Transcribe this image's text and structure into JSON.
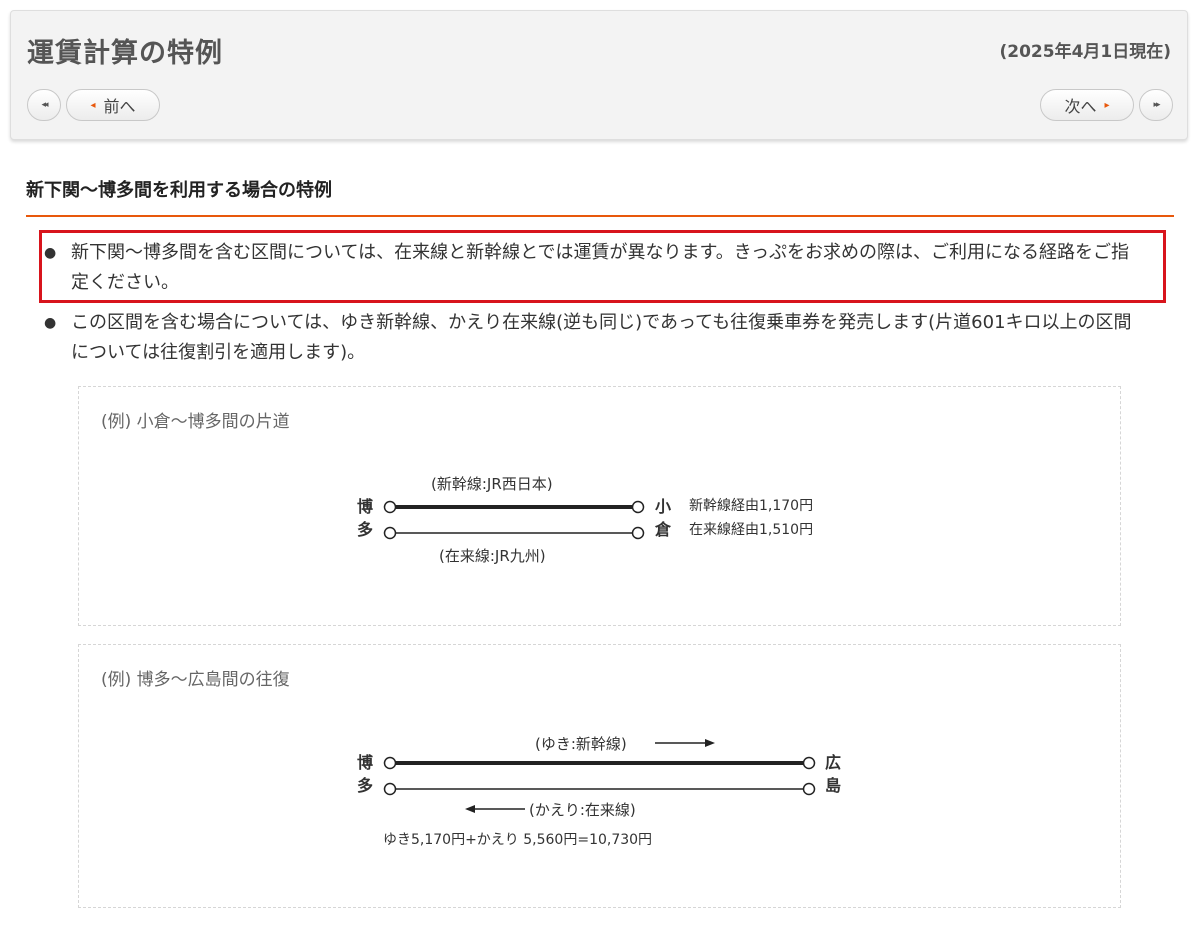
{
  "header": {
    "title": "運賃計算の特例",
    "as_of": "(2025年4月1日現在)",
    "nav": {
      "first_label": "◂◂",
      "prev_label": "前へ",
      "next_label": "次へ",
      "last_label": "▸▸"
    }
  },
  "section": {
    "title": "新下関～博多間を利用する場合の特例",
    "accent_color": "#e8580c"
  },
  "notes": [
    "新下関～博多間を含む区間については、在来線と新幹線とでは運賃が異なります。きっぷをお求めの際は、ご利用になる経路をご指定ください。",
    "この区間を含む場合については、ゆき新幹線、かえり在来線(逆も同じ)であっても往復乗車券を発売します(片道601キロ以上の区間については往復割引を適用します)。"
  ],
  "highlight_color": "#d8141c",
  "examples": [
    {
      "caption": "(例) 小倉～博多間の片道",
      "left_station": "博多",
      "right_station": "小倉",
      "top_line_label": "(新幹線:JR西日本)",
      "bottom_line_label": "(在来線:JR九州)",
      "fares": [
        "新幹線経由1,170円",
        "在来線経由1,510円"
      ]
    },
    {
      "caption": "(例) 博多～広島間の往復",
      "left_station": "博多",
      "right_station": "広島",
      "top_line_label": "(ゆき:新幹線)",
      "bottom_line_label": "(かえり:在来線)",
      "total": "ゆき5,170円+かえり 5,560円=10,730円"
    }
  ]
}
